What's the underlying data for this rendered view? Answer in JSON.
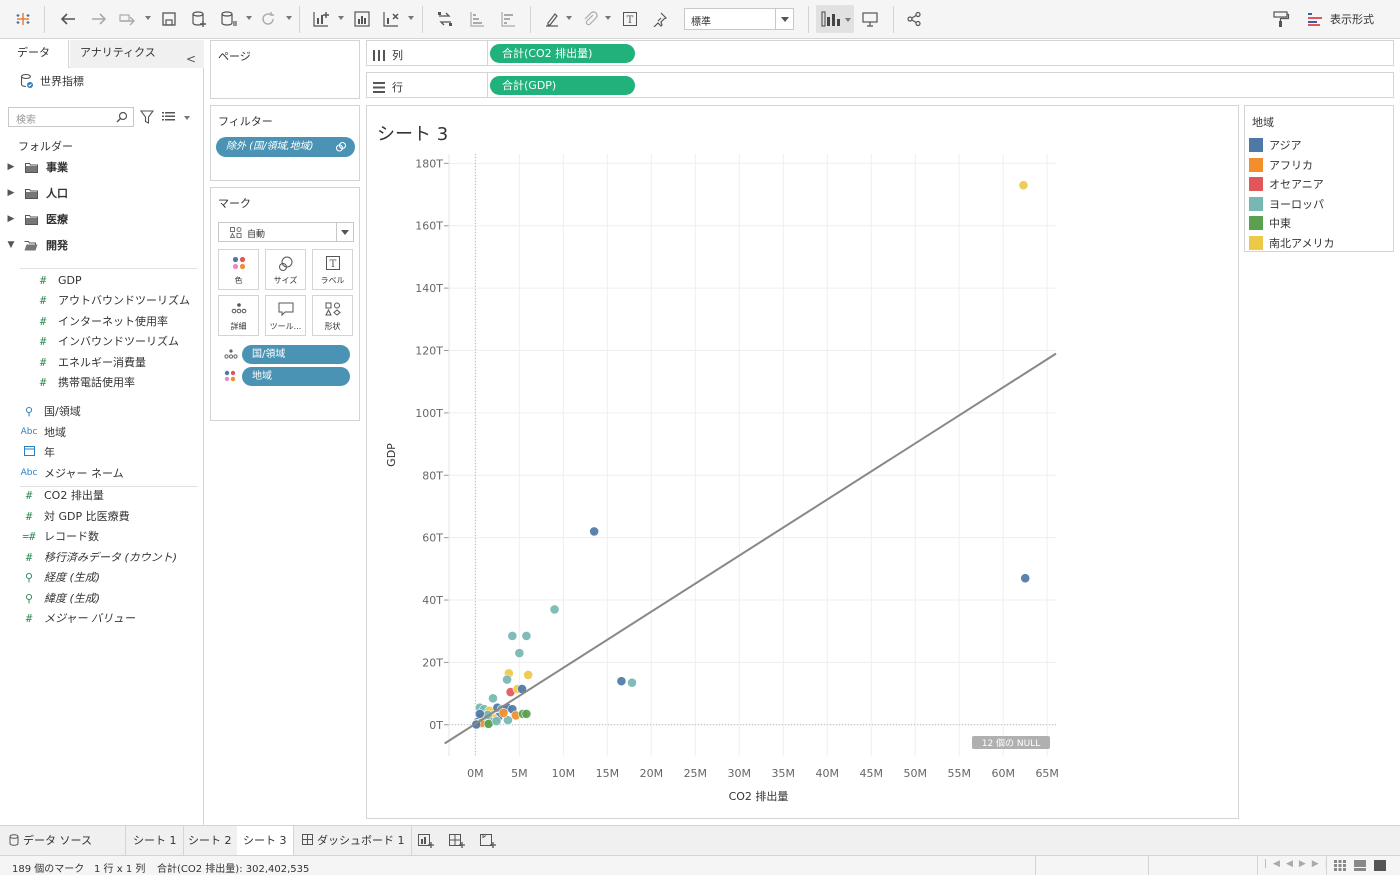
{
  "toolbar": {
    "fit_value": "標準",
    "display_format": "表示形式"
  },
  "data_pane": {
    "tab_data": "データ",
    "tab_analytics": "アナリティクス",
    "datasource": "世界指標",
    "search_placeholder": "検索",
    "folders_label": "フォルダー",
    "folders": [
      {
        "label": "事業",
        "expanded": false
      },
      {
        "label": "人口",
        "expanded": false
      },
      {
        "label": "医療",
        "expanded": false
      },
      {
        "label": "開発",
        "expanded": true
      }
    ],
    "dev_fields": [
      "GDP",
      "アウトバウンドツーリズム",
      "インターネット使用率",
      "インバウンドツーリズム",
      "エネルギー消費量",
      "携帯電話使用率"
    ],
    "dimensions": [
      {
        "icon": "globe",
        "label": "国/領域"
      },
      {
        "icon": "Abc",
        "label": "地域"
      },
      {
        "icon": "calendar",
        "label": "年"
      },
      {
        "icon": "Abc",
        "label": "メジャー ネーム"
      }
    ],
    "measures": [
      {
        "icon": "#",
        "label": "CO2 排出量",
        "italic": false
      },
      {
        "icon": "#",
        "label": "対 GDP 比医療費",
        "italic": false
      },
      {
        "icon": "=#",
        "label": "レコード数",
        "italic": false
      },
      {
        "icon": "#",
        "label": "移行済みデータ (カウント)",
        "italic": true
      },
      {
        "icon": "globe",
        "label": "経度 (生成)",
        "italic": true
      },
      {
        "icon": "globe",
        "label": "緯度 (生成)",
        "italic": true
      },
      {
        "icon": "#",
        "label": "メジャー バリュー",
        "italic": true
      }
    ]
  },
  "cards": {
    "pages_title": "ページ",
    "filters_title": "フィルター",
    "filter_pill": "除外 (国/領域,地域)",
    "marks_title": "マーク",
    "mark_type": "自動",
    "mark_buttons": [
      "色",
      "サイズ",
      "ラベル",
      "詳細",
      "ツール...",
      "形状"
    ],
    "mark_pills": [
      {
        "label": "国/領域",
        "icon": "detail"
      },
      {
        "label": "地域",
        "icon": "color"
      }
    ]
  },
  "shelves": {
    "columns_label": "列",
    "columns_pill": "合計(CO2 排出量)",
    "rows_label": "行",
    "rows_pill": "合計(GDP)"
  },
  "sheet": {
    "title": "シート 3",
    "null_badge": "12 個の NULL"
  },
  "legend": {
    "title": "地域",
    "items": [
      {
        "label": "アジア",
        "color": "#4e79a7"
      },
      {
        "label": "アフリカ",
        "color": "#f28e2b"
      },
      {
        "label": "オセアニア",
        "color": "#e15759"
      },
      {
        "label": "ヨーロッパ",
        "color": "#76b7b2"
      },
      {
        "label": "中東",
        "color": "#59a14f"
      },
      {
        "label": "南北アメリカ",
        "color": "#edc948"
      }
    ]
  },
  "chart_data": {
    "type": "scatter",
    "xlabel": "CO2 排出量",
    "ylabel": "GDP",
    "x_ticks": [
      "0M",
      "5M",
      "10M",
      "15M",
      "20M",
      "25M",
      "30M",
      "35M",
      "40M",
      "45M",
      "50M",
      "55M",
      "60M",
      "65M"
    ],
    "y_ticks": [
      "0T",
      "20T",
      "40T",
      "60T",
      "80T",
      "100T",
      "120T",
      "140T",
      "160T",
      "180T"
    ],
    "xlim": [
      -3,
      66
    ],
    "ylim": [
      -10,
      183
    ],
    "x_unit": "M",
    "y_unit": "T",
    "grid": true,
    "trend_line": {
      "x": [
        -3.5,
        66
      ],
      "y": [
        -6,
        119
      ]
    },
    "points": [
      {
        "x": 62.3,
        "y": 173,
        "region": "南北アメリカ"
      },
      {
        "x": 62.5,
        "y": 47,
        "region": "アジア"
      },
      {
        "x": 13.5,
        "y": 62,
        "region": "アジア"
      },
      {
        "x": 9,
        "y": 37,
        "region": "ヨーロッパ"
      },
      {
        "x": 4.2,
        "y": 28.5,
        "region": "ヨーロッパ"
      },
      {
        "x": 5.8,
        "y": 28.5,
        "region": "ヨーロッパ"
      },
      {
        "x": 5,
        "y": 23,
        "region": "ヨーロッパ"
      },
      {
        "x": 16.6,
        "y": 14,
        "region": "アジア"
      },
      {
        "x": 17.8,
        "y": 13.5,
        "region": "ヨーロッパ"
      },
      {
        "x": 3.8,
        "y": 16.5,
        "region": "南北アメリカ"
      },
      {
        "x": 6,
        "y": 16,
        "region": "南北アメリカ"
      },
      {
        "x": 3.6,
        "y": 14.5,
        "region": "ヨーロッパ"
      },
      {
        "x": 4,
        "y": 10.5,
        "region": "オセアニア"
      },
      {
        "x": 4.8,
        "y": 11.5,
        "region": "南北アメリカ"
      },
      {
        "x": 5.3,
        "y": 11.5,
        "region": "アジア"
      },
      {
        "x": 2,
        "y": 8.5,
        "region": "ヨーロッパ"
      },
      {
        "x": 0.5,
        "y": 5.5,
        "region": "ヨーロッパ"
      },
      {
        "x": 1,
        "y": 5,
        "region": "ヨーロッパ"
      },
      {
        "x": 1.6,
        "y": 4.5,
        "region": "南北アメリカ"
      },
      {
        "x": 2.5,
        "y": 5.5,
        "region": "アジア"
      },
      {
        "x": 3,
        "y": 5,
        "region": "ヨーロッパ"
      },
      {
        "x": 3.6,
        "y": 5.5,
        "region": "アジア"
      },
      {
        "x": 4.2,
        "y": 5,
        "region": "アジア"
      },
      {
        "x": 4.6,
        "y": 3,
        "region": "アフリカ"
      },
      {
        "x": 5.4,
        "y": 3.5,
        "region": "中東"
      },
      {
        "x": 5.8,
        "y": 3.5,
        "region": "中東"
      },
      {
        "x": 3.7,
        "y": 1.5,
        "region": "ヨーロッパ"
      },
      {
        "x": 2.6,
        "y": 2.5,
        "region": "アジア"
      },
      {
        "x": 2.1,
        "y": 2,
        "region": "南北アメリカ"
      },
      {
        "x": 1.8,
        "y": 1,
        "region": "ヨーロッパ"
      },
      {
        "x": 1.2,
        "y": 0.5,
        "region": "中東"
      },
      {
        "x": 0.9,
        "y": 1.5,
        "region": "アジア"
      },
      {
        "x": 0.6,
        "y": 2.5,
        "region": "アジア"
      },
      {
        "x": 0.3,
        "y": 1,
        "region": "アジア"
      },
      {
        "x": 0.2,
        "y": 0.3,
        "region": "ヨーロッパ"
      },
      {
        "x": 0.4,
        "y": 0.2,
        "region": "南北アメリカ"
      },
      {
        "x": 0.7,
        "y": 0.6,
        "region": "アフリカ"
      },
      {
        "x": 1.1,
        "y": 2.8,
        "region": "南北アメリカ"
      },
      {
        "x": 1.4,
        "y": 3.2,
        "region": "ヨーロッパ"
      },
      {
        "x": 0.1,
        "y": 0.1,
        "region": "アジア"
      },
      {
        "x": 0.5,
        "y": 3.5,
        "region": "アジア"
      },
      {
        "x": 1.5,
        "y": 0.3,
        "region": "中東"
      },
      {
        "x": 2.4,
        "y": 1.2,
        "region": "ヨーロッパ"
      },
      {
        "x": 3.2,
        "y": 3.8,
        "region": "アフリカ"
      }
    ]
  },
  "tabs": {
    "datasource": "データ ソース",
    "sheets": [
      "シート 1",
      "シート 2",
      "シート 3"
    ],
    "dashboard": "ダッシュボード 1"
  },
  "status": {
    "marks": "189 個のマーク",
    "grid": "1 行 x 1 列",
    "sum": "合計(CO2 排出量): 302,402,535"
  }
}
